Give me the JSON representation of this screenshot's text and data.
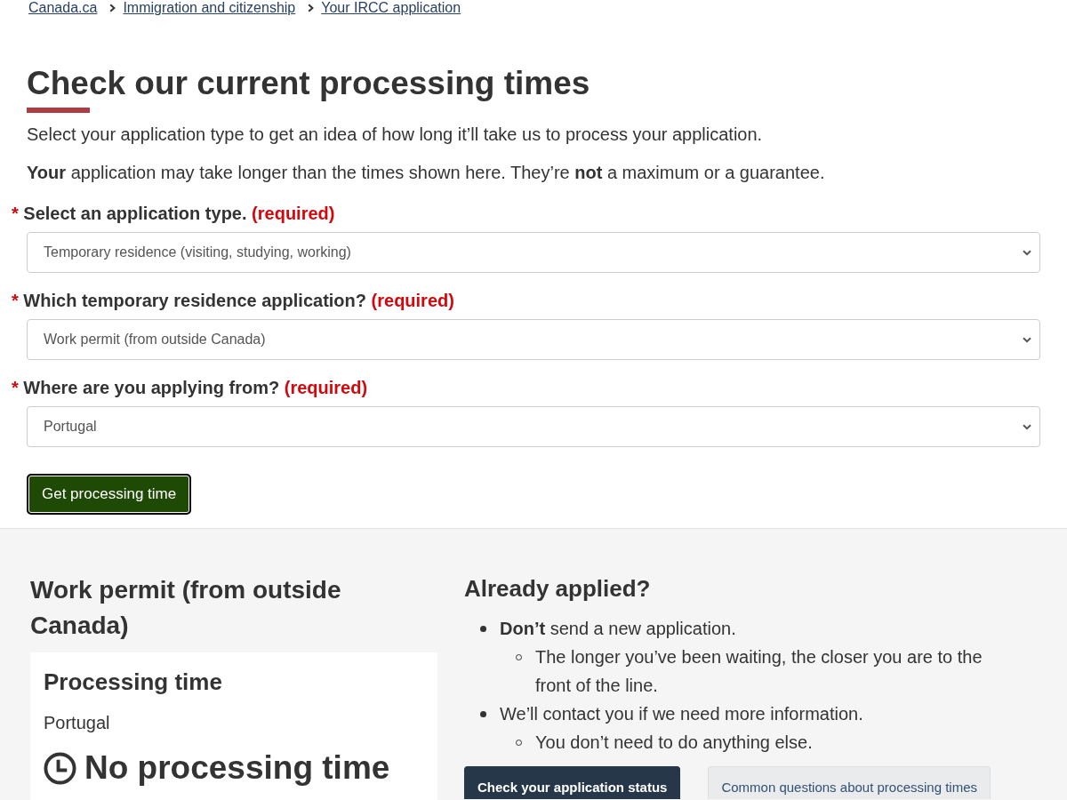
{
  "breadcrumb": [
    {
      "label": "Canada.ca"
    },
    {
      "label": "Immigration and citizenship"
    },
    {
      "label": "Your IRCC application"
    }
  ],
  "heading": "Check our current processing times",
  "intro": [
    "Select your application type to get an idea of how long it’ll take us to process your application.",
    "**Your** application may take longer than the times shown here. They’re **not** a maximum or a guarantee."
  ],
  "form": {
    "fields": [
      {
        "mark": "*",
        "label": "Select an application type.",
        "required_note": "(required)",
        "value": "Temporary residence (visiting, studying, working)"
      },
      {
        "mark": "*",
        "label": "Which temporary residence application?",
        "required_note": "(required)",
        "value": "Work permit (from outside Canada)"
      },
      {
        "mark": "*",
        "label": "Where are you applying from?",
        "required_note": "(required)",
        "value": "Portugal"
      }
    ],
    "submit": "Get processing time"
  },
  "result": {
    "title": "Work permit (from outside Canada)",
    "card": {
      "heading": "Processing time",
      "country": "Portugal",
      "time": "No processing time"
    }
  },
  "already_applied": {
    "heading": "Already applied?",
    "items": [
      {
        "text": "**Don’t** send a new application.",
        "children": [
          {
            "text": "The longer you’ve been waiting, the closer you are to the front of the line."
          }
        ]
      },
      {
        "text": "We’ll contact you if we need more information.",
        "children": [
          {
            "text": "You don’t need to do anything else."
          }
        ]
      }
    ],
    "buttons": [
      {
        "label": "Check your application status",
        "kind": "primary"
      },
      {
        "label": "Common questions about processing times",
        "kind": "secondary"
      }
    ]
  }
}
